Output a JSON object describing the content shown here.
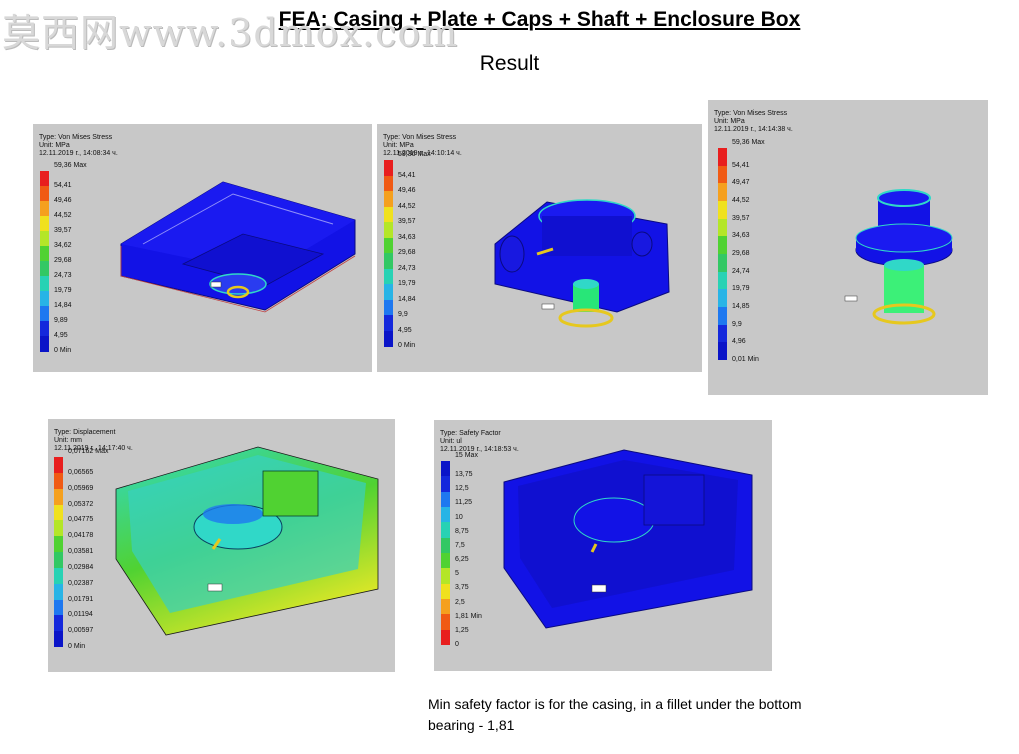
{
  "watermark": "莫西网www.3dmox.com",
  "title": "FEA: Casing + Plate + Caps + Shaft + Enclosure Box",
  "subtitle": "Result",
  "note": "Min safety factor is for the casing, in a fillet under the bottom bearing - 1,81",
  "panels": [
    {
      "type": "Type: Von Mises Stress",
      "unit": "Unit: MPa",
      "date": "12.11.2019 г., 14:08:34 ч.",
      "max": "59,36 Max",
      "labels": [
        "54,41",
        "49,46",
        "44,52",
        "39,57",
        "34,62",
        "29,68",
        "24,73",
        "19,79",
        "14,84",
        "9,89",
        "4,95",
        "0 Min"
      ]
    },
    {
      "type": "Type: Von Mises Stress",
      "unit": "Unit: MPa",
      "date": "12.11.2019 г., 14:10:14 ч.",
      "max": "59,36 Max",
      "labels": [
        "54,41",
        "49,46",
        "44,52",
        "39,57",
        "34,63",
        "29,68",
        "24,73",
        "19,79",
        "14,84",
        "9,9",
        "4,95",
        "0 Min"
      ]
    },
    {
      "type": "Type: Von Mises Stress",
      "unit": "Unit: MPa",
      "date": "12.11.2019 г., 14:14:38 ч.",
      "max": "59,36 Max",
      "labels": [
        "54,41",
        "49,47",
        "44,52",
        "39,57",
        "34,63",
        "29,68",
        "24,74",
        "19,79",
        "14,85",
        "9,9",
        "4,96",
        "0,01 Min"
      ]
    },
    {
      "type": "Type: Displacement",
      "unit": "Unit: mm",
      "date": "12.11.2019 г., 14:17:40 ч.",
      "max": "0,07162 Max",
      "labels": [
        "0,06565",
        "0,05969",
        "0,05372",
        "0,04775",
        "0,04178",
        "0,03581",
        "0,02984",
        "0,02387",
        "0,01791",
        "0,01194",
        "0,00597",
        "0 Min"
      ]
    },
    {
      "type": "Type: Safety Factor",
      "unit": "Unit: ul",
      "date": "12.11.2019 г., 14:18:53 ч.",
      "max": "15 Max",
      "labels": [
        "13,75",
        "12,5",
        "11,25",
        "10",
        "8,75",
        "7,5",
        "6,25",
        "5",
        "3,75",
        "2,5",
        "1,81 Min",
        "1,25",
        "0"
      ]
    }
  ],
  "colors": {
    "panel_bg": "#c8c8c8",
    "model_blue": "#1212e6",
    "stress_scale": [
      "#e81e1e",
      "#f05a14",
      "#f5a01e",
      "#f0e11e",
      "#b4e628",
      "#50d232",
      "#32c864",
      "#28d2b4",
      "#28b4e6",
      "#1e78f0",
      "#1428dc",
      "#0a14c8"
    ],
    "safety_scale": [
      "#0a14c8",
      "#1428dc",
      "#1e78f0",
      "#28b4e6",
      "#28d2b4",
      "#32c864",
      "#50d232",
      "#b4e628",
      "#f0e11e",
      "#f5a01e",
      "#f05a14",
      "#e81e1e"
    ]
  }
}
